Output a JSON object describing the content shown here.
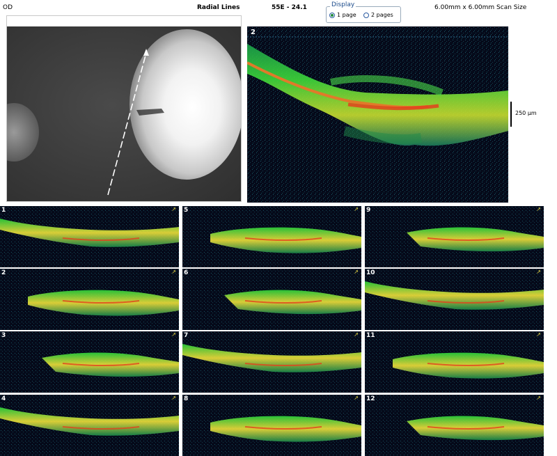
{
  "header": {
    "eye": "OD",
    "scan_type": "Radial Lines",
    "scan_id": "55E - 24.1",
    "scan_size": "6.00mm x 6.00mm Scan Size"
  },
  "display": {
    "legend": "Display",
    "options": [
      {
        "label": "1 page",
        "selected": true
      },
      {
        "label": "2 pages",
        "selected": false
      }
    ]
  },
  "main_scan": {
    "number": "2",
    "scale_label": "250 µm"
  },
  "thumbnails": [
    {
      "number": "1"
    },
    {
      "number": "5"
    },
    {
      "number": "9"
    },
    {
      "number": "2"
    },
    {
      "number": "6"
    },
    {
      "number": "10"
    },
    {
      "number": "3"
    },
    {
      "number": "7"
    },
    {
      "number": "11"
    },
    {
      "number": "4"
    },
    {
      "number": "8"
    },
    {
      "number": "12"
    }
  ],
  "colors": {
    "retina_green": "#2bd43a",
    "retina_yellow": "#f0e23a",
    "retina_red": "#e2421d",
    "background": "#050a1a"
  }
}
